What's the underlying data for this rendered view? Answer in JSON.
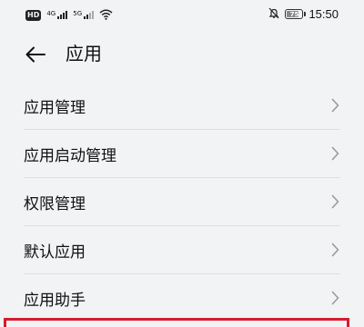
{
  "status_bar": {
    "hd_badge": "HD",
    "signal_1_type": "4G",
    "signal_2_type": "5G",
    "battery_level": "75",
    "time": "15:50",
    "icons": [
      "hd-badge-icon",
      "cellular-signal-icon",
      "cellular-signal-icon",
      "wifi-icon",
      "mute-bell-icon",
      "battery-icon"
    ]
  },
  "header": {
    "title": "应用",
    "back_icon": "back-arrow-icon"
  },
  "list": {
    "items": [
      {
        "label": "应用管理",
        "icon": "chevron-right-icon"
      },
      {
        "label": "应用启动管理",
        "icon": "chevron-right-icon"
      },
      {
        "label": "权限管理",
        "icon": "chevron-right-icon"
      },
      {
        "label": "默认应用",
        "icon": "chevron-right-icon"
      },
      {
        "label": "应用助手",
        "icon": "chevron-right-icon"
      }
    ]
  },
  "colors": {
    "background": "#f1f3f5",
    "text": "#111111",
    "divider": "#dcdee0",
    "chevron": "#9a9a9a",
    "highlight": "#d51b2e"
  }
}
